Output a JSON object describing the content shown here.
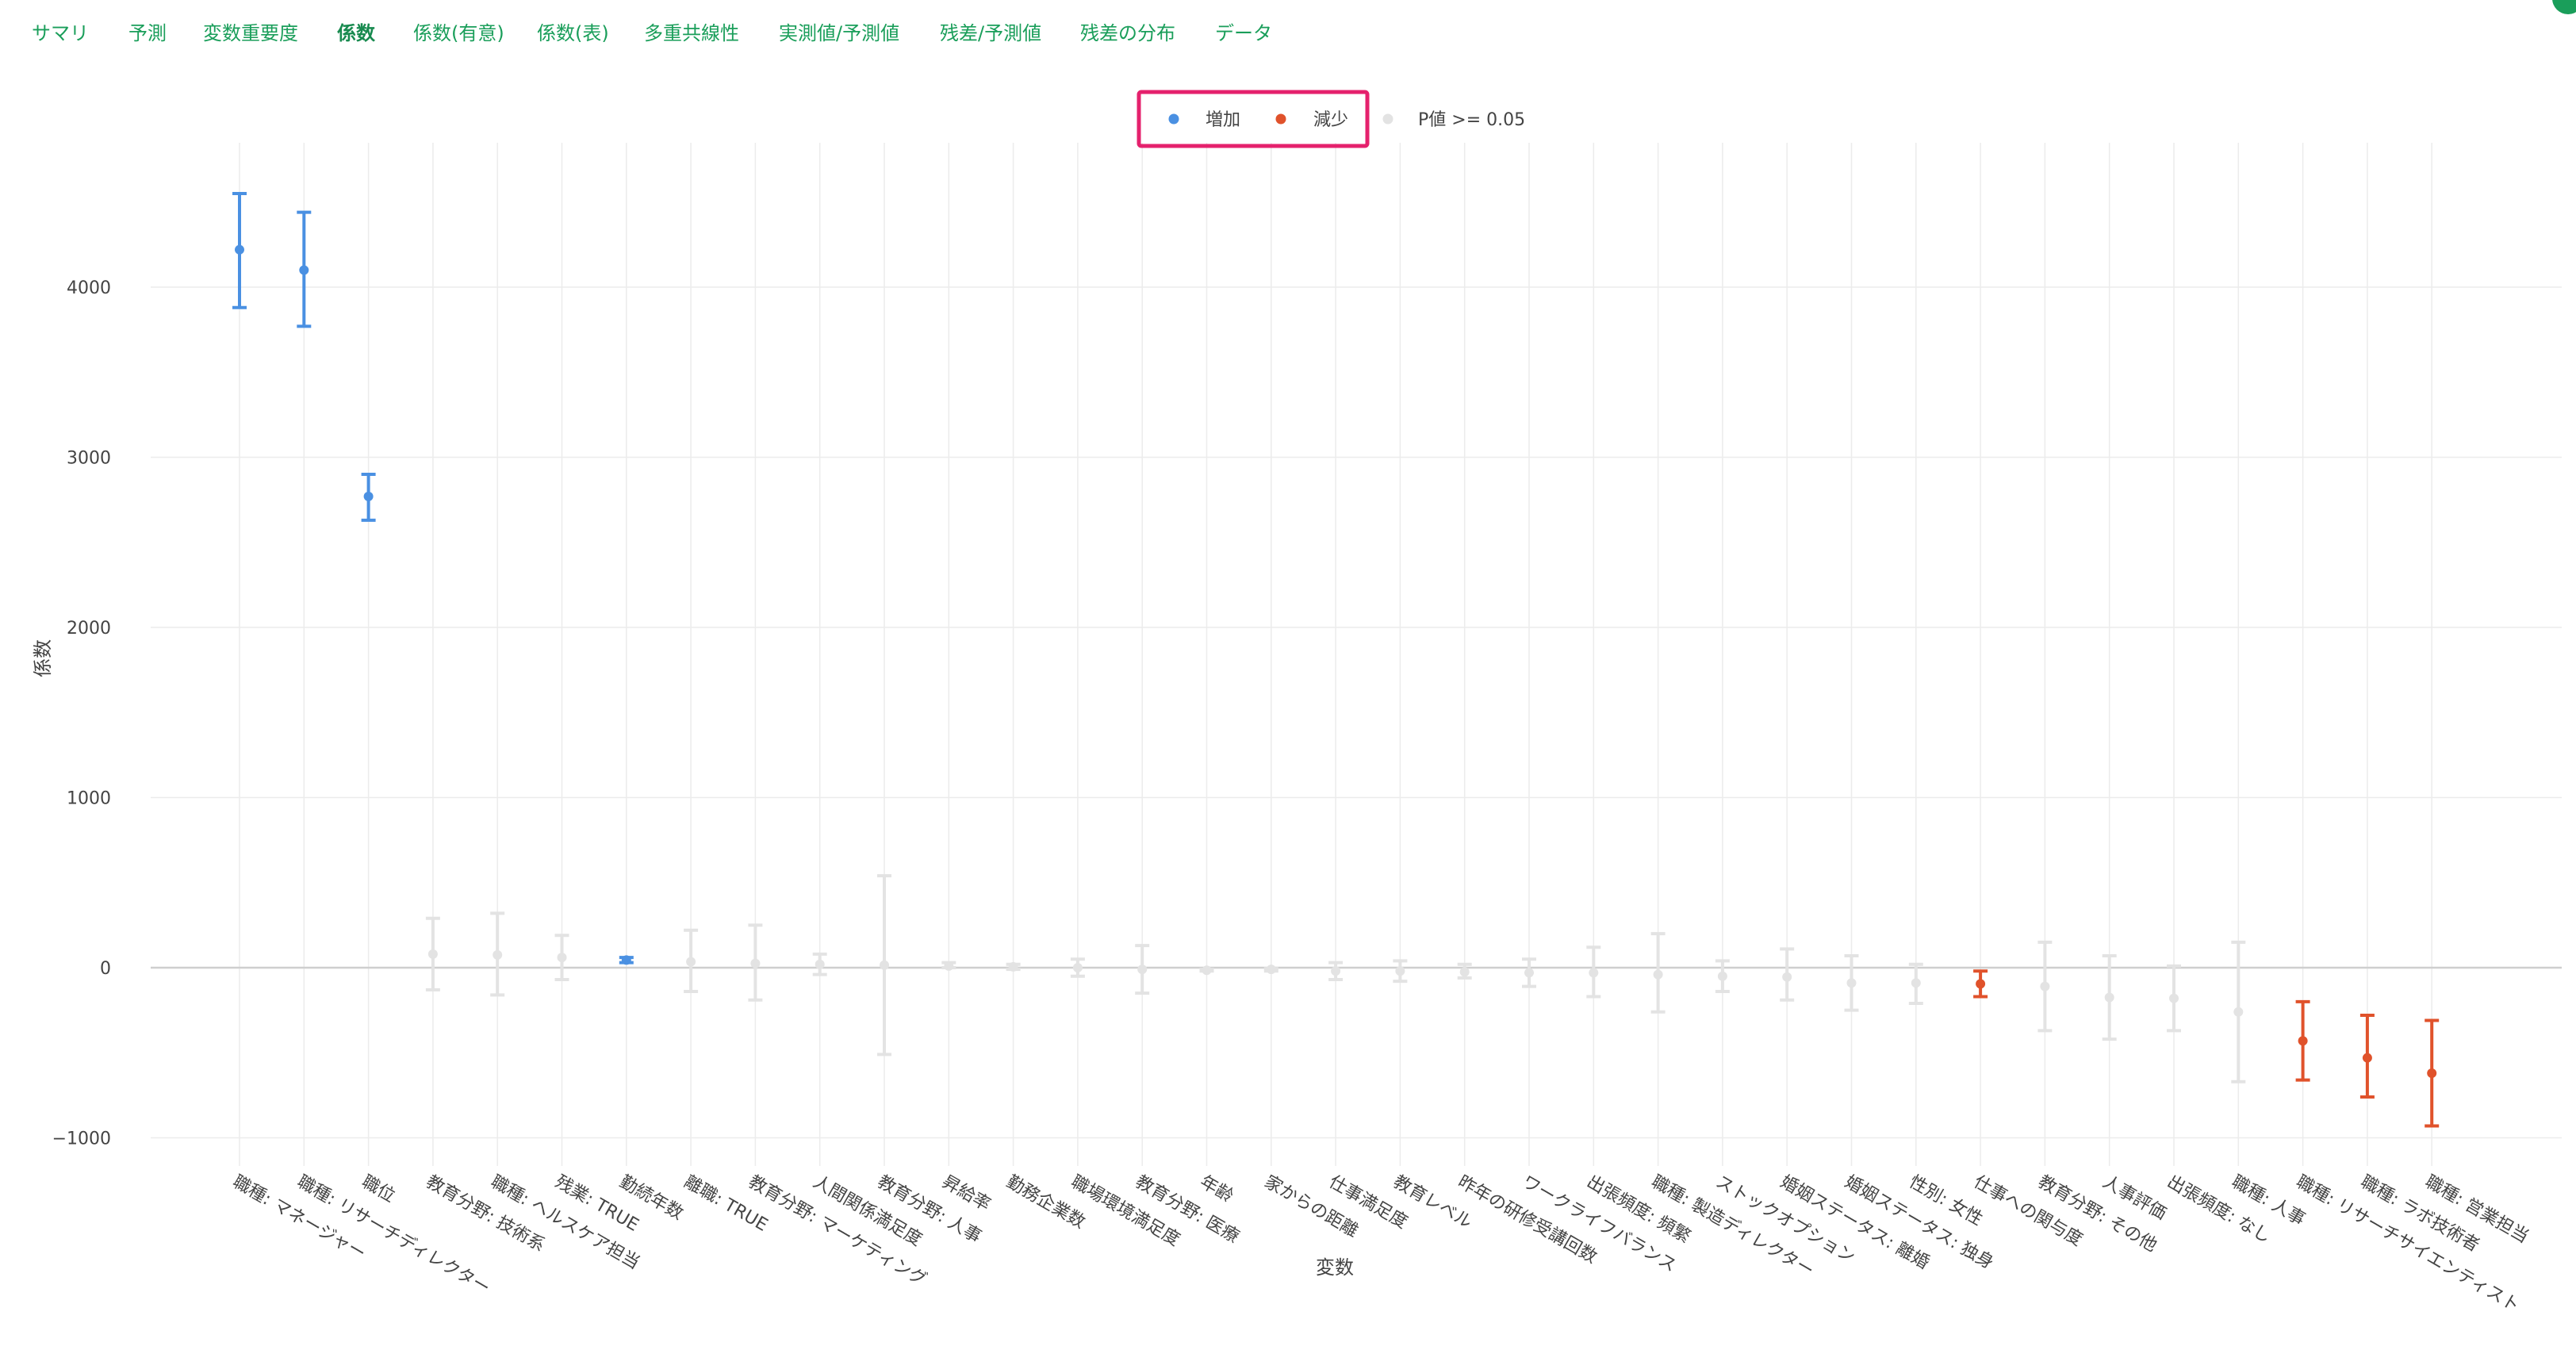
{
  "tabs": [
    {
      "label": "サマリ",
      "active": false
    },
    {
      "label": "予測",
      "active": false
    },
    {
      "label": "変数重要度",
      "active": false
    },
    {
      "label": "係数",
      "active": true
    },
    {
      "label": "係数(有意)",
      "active": false
    },
    {
      "label": "係数(表)",
      "active": false
    },
    {
      "label": "多重共線性",
      "active": false
    },
    {
      "label": "実測値/予測値",
      "active": false
    },
    {
      "label": "残差/予測値",
      "active": false
    },
    {
      "label": "残差の分布",
      "active": false
    },
    {
      "label": "データ",
      "active": false
    }
  ],
  "colors": {
    "increase": "#4a90e2",
    "decrease": "#e0522b",
    "not_significant": "#e3e3e3",
    "legend_highlight": "#e5216d",
    "tab_text": "#1a9e5a",
    "grid": "#ececec",
    "zero_line": "#cfcfcf"
  },
  "chart_data": {
    "type": "errorbar",
    "xlabel": "変数",
    "ylabel": "係数",
    "ylim": [
      -1100,
      4600
    ],
    "yticks": [
      -1000,
      0,
      1000,
      2000,
      3000,
      4000
    ],
    "ytick_labels": [
      "−1000",
      "0",
      "1000",
      "2000",
      "3000",
      "4000"
    ],
    "grid": true,
    "legend": {
      "placement": "top-center",
      "highlighted": true,
      "items": [
        {
          "label": "増加",
          "status": "increase"
        },
        {
          "label": "減少",
          "status": "decrease"
        },
        {
          "label": "P値 >= 0.05",
          "status": "not_significant"
        }
      ]
    },
    "categories": [
      "職種: マネージャー",
      "職種: リサーチディレクター",
      "職位",
      "教育分野: 技術系",
      "職種: ヘルスケア担当",
      "残業: TRUE",
      "勤続年数",
      "離職: TRUE",
      "教育分野: マーケティング",
      "人間関係満足度",
      "教育分野: 人事",
      "昇給率",
      "勤務企業数",
      "職場環境満足度",
      "教育分野: 医療",
      "年齢",
      "家からの距離",
      "仕事満足度",
      "教育レベル",
      "昨年の研修受講回数",
      "ワークライフバランス",
      "出張頻度: 頻繁",
      "職種: 製造ディレクター",
      "ストックオプション",
      "婚姻ステータス: 離婚",
      "婚姻ステータス: 独身",
      "性別: 女性",
      "仕事への関与度",
      "教育分野: その他",
      "人事評価",
      "出張頻度: なし",
      "職種: 人事",
      "職種: リサーチサイエンティスト",
      "職種: ラボ技術者",
      "職種: 営業担当"
    ],
    "values": [
      4220,
      4100,
      2770,
      80,
      75,
      60,
      45,
      35,
      25,
      20,
      15,
      10,
      5,
      0,
      -10,
      -15,
      -10,
      -20,
      -20,
      -25,
      -30,
      -30,
      -40,
      -50,
      -55,
      -90,
      -90,
      -95,
      -110,
      -175,
      -180,
      -260,
      -430,
      -530,
      -620
    ],
    "lower": [
      3880,
      3770,
      2630,
      -130,
      -160,
      -70,
      30,
      -140,
      -190,
      -40,
      -510,
      0,
      -10,
      -50,
      -150,
      -20,
      -20,
      -70,
      -80,
      -60,
      -110,
      -170,
      -260,
      -140,
      -190,
      -250,
      -210,
      -170,
      -370,
      -420,
      -370,
      -670,
      -660,
      -760,
      -930
    ],
    "upper": [
      4550,
      4440,
      2900,
      290,
      320,
      190,
      60,
      220,
      250,
      80,
      540,
      30,
      20,
      50,
      130,
      -10,
      -5,
      30,
      40,
      20,
      50,
      120,
      200,
      40,
      110,
      70,
      20,
      -20,
      150,
      70,
      10,
      150,
      -200,
      -280,
      -310
    ],
    "status": [
      "increase",
      "increase",
      "increase",
      "not_significant",
      "not_significant",
      "not_significant",
      "increase",
      "not_significant",
      "not_significant",
      "not_significant",
      "not_significant",
      "not_significant",
      "not_significant",
      "not_significant",
      "not_significant",
      "not_significant",
      "not_significant",
      "not_significant",
      "not_significant",
      "not_significant",
      "not_significant",
      "not_significant",
      "not_significant",
      "not_significant",
      "not_significant",
      "not_significant",
      "not_significant",
      "decrease",
      "not_significant",
      "not_significant",
      "not_significant",
      "not_significant",
      "decrease",
      "decrease",
      "decrease"
    ]
  }
}
